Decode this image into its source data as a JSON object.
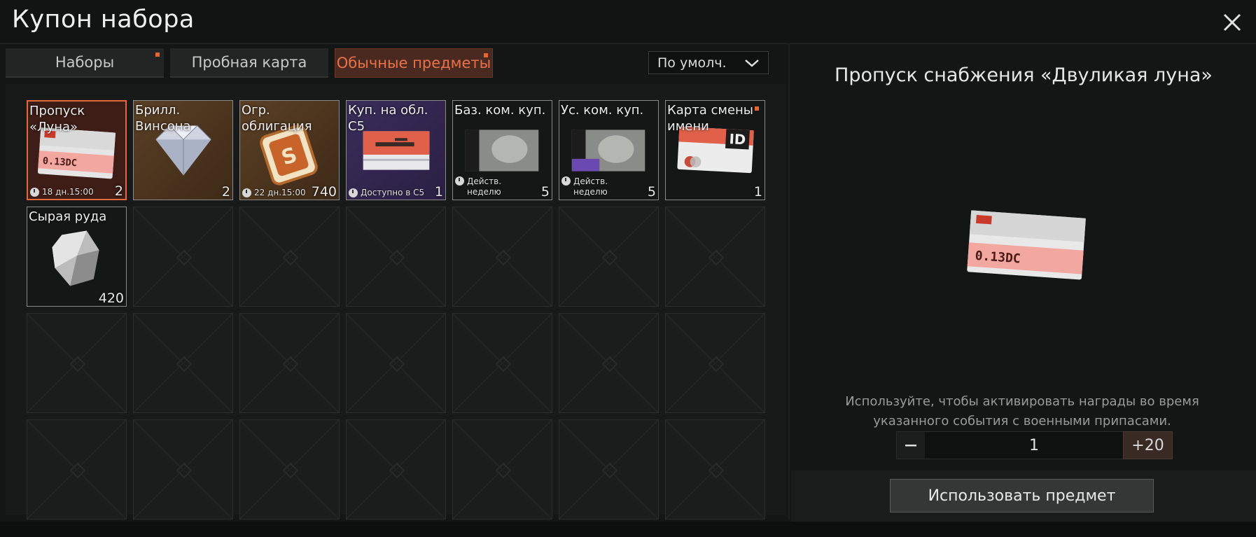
{
  "header": {
    "title": "Купон набора"
  },
  "tabs": [
    {
      "label": "Наборы",
      "active": false,
      "has_dot": true
    },
    {
      "label": "Пробная карта",
      "active": false,
      "has_dot": false
    },
    {
      "label": "Обычные предметы",
      "active": true,
      "has_dot": true
    }
  ],
  "sort": {
    "label": "По умолч."
  },
  "items": [
    {
      "name": "Пропуск\n«Луна»",
      "count": "2",
      "timer": "18 дн.15:00",
      "selected": true
    },
    {
      "name": "Брилл.\nВинсона",
      "count": "2",
      "timer": ""
    },
    {
      "name": "Огр.\nоблигация",
      "count": "740",
      "timer": "22 дн.15:00"
    },
    {
      "name": "Куп. на обл. С5",
      "count": "1",
      "timer": "Доступно в С5"
    },
    {
      "name": "Баз. ком. куп.",
      "count": "5",
      "timer": "Действ.\nнеделю"
    },
    {
      "name": "Ус. ком. куп.",
      "count": "5",
      "timer": "Действ.\nнеделю"
    },
    {
      "name": "Карта смены\nимени",
      "count": "1",
      "timer": "",
      "has_dot": true
    },
    {
      "name": "Сырая руда",
      "count": "420",
      "timer": ""
    }
  ],
  "item_art_text": {
    "pass_card": "0.13DC",
    "id_card": "ID"
  },
  "detail": {
    "title": "Пропуск снабжения «Двуликая луна»",
    "description": "Используйте, чтобы активировать награды во время указанного события с военными припасами.",
    "quantity": "1",
    "plus20_label": "+20",
    "use_button": "Использовать предмет"
  },
  "colors": {
    "accent": "#e06a3c",
    "tab_active_text": "#e8714a",
    "background": "#141615"
  }
}
